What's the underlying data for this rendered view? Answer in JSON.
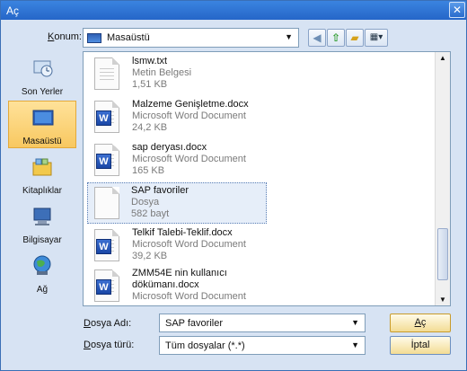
{
  "window": {
    "title": "Aç",
    "close_glyph": "✕"
  },
  "location": {
    "label_underlined": "K",
    "label_rest": "onum:",
    "value": "Masaüstü"
  },
  "toolbar": {
    "back_icon": "back-arrow-icon",
    "up_icon": "up-folder-icon",
    "new_folder_icon": "new-folder-icon",
    "views_icon": "views-menu-icon"
  },
  "places": [
    {
      "label": "Son Yerler",
      "icon": "recent-places-icon",
      "active": false
    },
    {
      "label": "Masaüstü",
      "icon": "desktop-icon",
      "active": true
    },
    {
      "label": "Kitaplıklar",
      "icon": "libraries-icon",
      "active": false
    },
    {
      "label": "Bilgisayar",
      "icon": "computer-icon",
      "active": false
    },
    {
      "label": "Ağ",
      "icon": "network-icon",
      "active": false
    }
  ],
  "files": [
    {
      "name": "lsmw.txt",
      "type": "Metin Belgesi",
      "size": "1,51 KB",
      "icon": "text-file-icon",
      "selected": false
    },
    {
      "name": "Malzeme Genişletme.docx",
      "type": "Microsoft Word Document",
      "size": "24,2 KB",
      "icon": "word-document-icon",
      "selected": false
    },
    {
      "name": "sap deryası.docx",
      "type": "Microsoft Word Document",
      "size": "165 KB",
      "icon": "word-document-icon",
      "selected": false
    },
    {
      "name": "SAP favoriler",
      "type": "Dosya",
      "size": "582 bayt",
      "icon": "generic-file-icon",
      "selected": true
    },
    {
      "name": "Telkif Talebi-Teklif.docx",
      "type": "Microsoft Word Document",
      "size": "39,2 KB",
      "icon": "word-document-icon",
      "selected": false
    },
    {
      "name": "ZMM54E nin kullanıcı",
      "name_line2": "dökümanı.docx",
      "type": "Microsoft Word Document",
      "icon": "word-document-icon",
      "selected": false
    }
  ],
  "filename": {
    "label_underlined": "D",
    "label_rest": "osya Adı:",
    "value": "SAP favoriler"
  },
  "filetype": {
    "label_underlined": "D",
    "label_rest": "osya türü:",
    "value": "Tüm dosyalar (*.*)"
  },
  "buttons": {
    "open_underlined": "A",
    "open_rest": "ç",
    "cancel": "İptal"
  },
  "colors": {
    "accent": "#2566c8",
    "selection": "#e6eef9",
    "active_place": "#f8c860"
  }
}
